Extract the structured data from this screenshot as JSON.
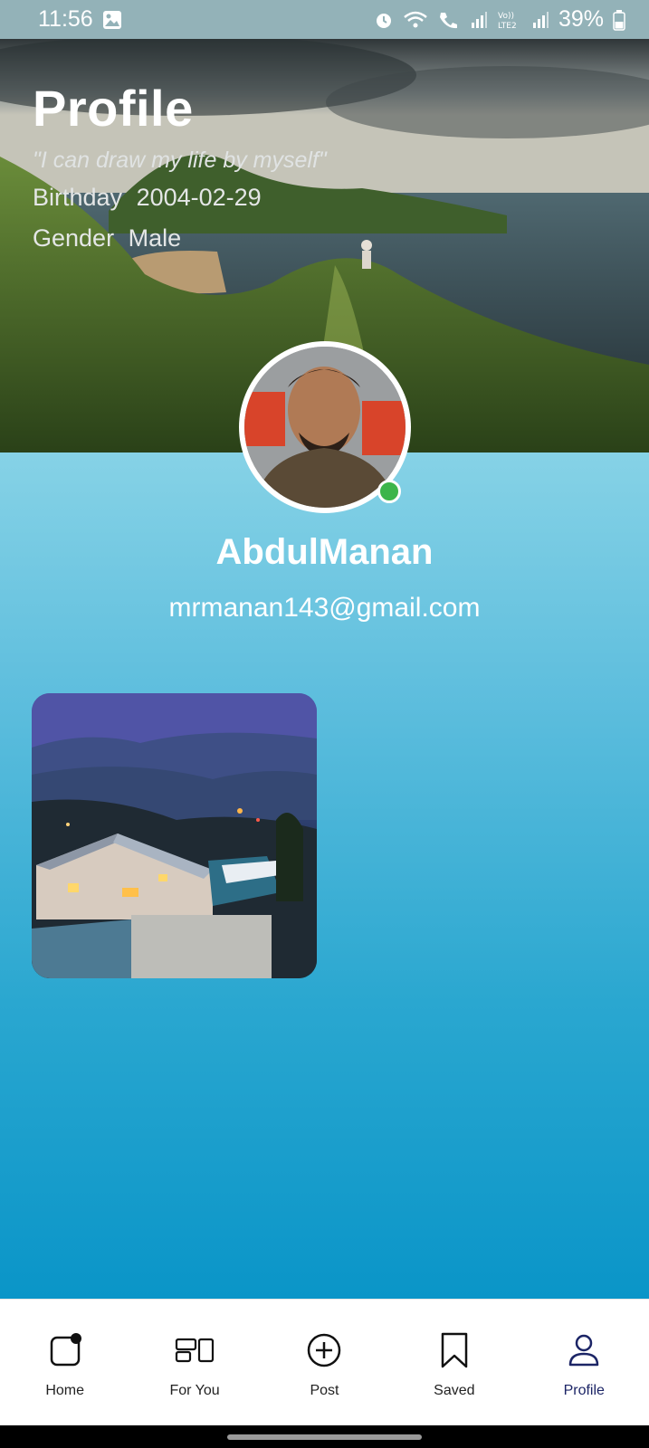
{
  "status_bar": {
    "time": "11:56",
    "battery": "39%",
    "icons": [
      "gallery-icon",
      "alarm-icon",
      "wifi-icon",
      "wifi-call-icon",
      "signal-icon",
      "volte-icon",
      "signal-icon",
      "battery-icon"
    ]
  },
  "header": {
    "title": "Profile",
    "quote": "\"I can draw my life by myself\"",
    "birthday_label": "Birthday",
    "birthday_value": "2004-02-29",
    "gender_label": "Gender",
    "gender_value": "Male"
  },
  "profile": {
    "username": "AbdulManan",
    "email": "mrmanan143@gmail.com",
    "online_status_color": "#3cb54a"
  },
  "posts": [
    {
      "type": "image"
    }
  ],
  "bottom_nav": {
    "items": [
      {
        "label": "Home",
        "icon": "home-icon"
      },
      {
        "label": "For You",
        "icon": "for-you-icon"
      },
      {
        "label": "Post",
        "icon": "add-circle-icon"
      },
      {
        "label": "Saved",
        "icon": "bookmark-icon"
      },
      {
        "label": "Profile",
        "icon": "person-icon",
        "active": true
      }
    ],
    "active_color": "#1c2566"
  },
  "colors": {
    "gradient_top": "#86d2e6",
    "gradient_bottom": "#0a95c8"
  }
}
